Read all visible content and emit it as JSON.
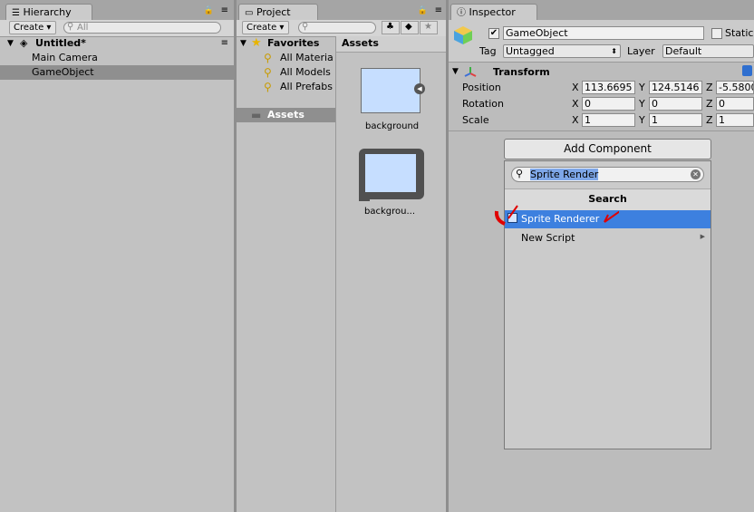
{
  "hierarchy": {
    "tab_label": "Hierarchy",
    "create_label": "Create",
    "search_placeholder": "All",
    "scene_name": "Untitled*",
    "items": [
      "Main Camera",
      "GameObject"
    ]
  },
  "project": {
    "tab_label": "Project",
    "create_label": "Create",
    "favorites_label": "Favorites",
    "favorites": [
      "All Materia",
      "All Models",
      "All Prefabs"
    ],
    "assets_tree_label": "Assets",
    "assets_header": "Assets",
    "assets": [
      "background",
      "backgrou..."
    ]
  },
  "inspector": {
    "tab_label": "Inspector",
    "object_name": "GameObject",
    "static_label": "Static",
    "tag_label": "Tag",
    "tag_value": "Untagged",
    "layer_label": "Layer",
    "layer_value": "Default",
    "transform_label": "Transform",
    "rows": [
      {
        "label": "Position",
        "x": "113.6695",
        "y": "124.5146",
        "z": "-5.5800"
      },
      {
        "label": "Rotation",
        "x": "0",
        "y": "0",
        "z": "0"
      },
      {
        "label": "Scale",
        "x": "1",
        "y": "1",
        "z": "1"
      }
    ],
    "axis_x": "X",
    "axis_y": "Y",
    "axis_z": "Z",
    "add_component_label": "Add Component",
    "popup": {
      "search_value": "Sprite Render",
      "header": "Search",
      "items": [
        "Sprite Renderer",
        "New Script"
      ]
    }
  },
  "colors": {
    "selection": "#3d80df",
    "panel_bg": "#c2c2c2",
    "annotation_red": "#e00000"
  }
}
